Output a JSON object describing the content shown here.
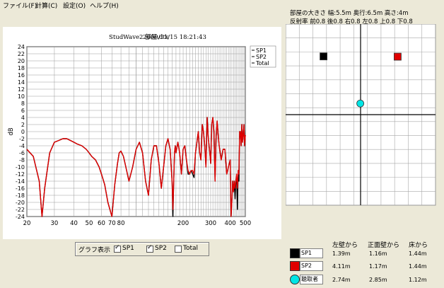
{
  "menu": [
    "ファイル(F)",
    "計算(C)",
    "設定(O)",
    "ヘルプ(H)"
  ],
  "room": {
    "size_text": "部屋の大きさ 幅:5.5m 奥行:6.5m 高さ:4m",
    "reflection_text": "反射率  前0.8  後0.8  右0.8  左0.8  上0.8  下0.8"
  },
  "graph_options": {
    "label": "グラフ表示",
    "items": [
      {
        "label": "SP1",
        "checked": true
      },
      {
        "label": "SP2",
        "checked": true
      },
      {
        "label": "Total",
        "checked": false
      }
    ]
  },
  "distance_table": {
    "headers": [
      "左壁から",
      "正面壁から",
      "床から"
    ],
    "rows": [
      {
        "name": "SP1",
        "color": "#000000",
        "shape": "square",
        "values": [
          "1.39m",
          "1.16m",
          "1.44m"
        ]
      },
      {
        "name": "SP2",
        "color": "#e00000",
        "shape": "square",
        "values": [
          "4.11m",
          "1.17m",
          "1.44m"
        ]
      },
      {
        "name": "聴取者",
        "color": "#00e5e5",
        "shape": "circle",
        "values": [
          "2.74m",
          "2.85m",
          "1.12m"
        ]
      }
    ]
  },
  "chart_data": {
    "type": "line",
    "title": "StudWave2 部屋.dtx",
    "timestamp": "2009/11/15 18:21:43",
    "ylabel": "dB",
    "xlabel": "",
    "x_scale": "log",
    "xlim": [
      20,
      500
    ],
    "ylim": [
      -24,
      24
    ],
    "x_ticks": [
      20,
      30,
      40,
      50,
      60,
      70,
      80,
      100,
      200,
      300,
      400,
      500
    ],
    "x_tick_labels": [
      "20",
      "30",
      "40",
      "50",
      "60",
      "70",
      "80",
      "",
      "200",
      "300",
      "400",
      "500"
    ],
    "y_ticks": [
      24,
      22,
      20,
      18,
      16,
      14,
      12,
      10,
      8,
      6,
      4,
      2,
      0,
      -2,
      -4,
      -6,
      -8,
      -10,
      -12,
      -14,
      -16,
      -18,
      -20,
      -22,
      -24
    ],
    "grid": true,
    "legend": {
      "position": "top-right",
      "entries": [
        "SP1",
        "SP2",
        "Total"
      ]
    },
    "series": [
      {
        "name": "SP1",
        "color": "#000000",
        "x": [
          20,
          22,
          24,
          25,
          26,
          28,
          30,
          32,
          34,
          36,
          38,
          40,
          42,
          45,
          48,
          50,
          52,
          55,
          58,
          60,
          63,
          66,
          70,
          73,
          76,
          78,
          80,
          83,
          86,
          90,
          95,
          100,
          105,
          110,
          115,
          120,
          125,
          130,
          135,
          140,
          145,
          150,
          155,
          160,
          165,
          170,
          172,
          174,
          176,
          178,
          180,
          185,
          190,
          195,
          200,
          205,
          210,
          215,
          220,
          225,
          230,
          235,
          240,
          245,
          250,
          255,
          260,
          265,
          270,
          275,
          280,
          285,
          290,
          295,
          300,
          305,
          310,
          315,
          320,
          325,
          330,
          335,
          340,
          350,
          360,
          370,
          380,
          390,
          400,
          405,
          410,
          415,
          420,
          425,
          430,
          435,
          440,
          445,
          450,
          455,
          460,
          465,
          470,
          475,
          480,
          485,
          490,
          495,
          500
        ],
        "y": [
          -5,
          -7,
          -14,
          -24,
          -16,
          -6,
          -3,
          -2.5,
          -2,
          -2,
          -2.5,
          -3,
          -3.5,
          -4,
          -5,
          -6,
          -7,
          -8,
          -10,
          -12,
          -15,
          -20,
          -24,
          -15,
          -9,
          -6,
          -5.5,
          -7,
          -10,
          -14,
          -10,
          -5,
          -3,
          -6,
          -14,
          -18,
          -8,
          -4,
          -4,
          -9,
          -16,
          -10,
          -4,
          -2,
          -5,
          -14,
          -24,
          -14,
          -6,
          -4,
          -6,
          -3,
          -6,
          -12,
          -5,
          -4,
          -8,
          -12,
          -12,
          -11,
          -12,
          -13,
          -6,
          -3,
          0,
          -6,
          -8,
          2,
          0,
          -4,
          -10,
          4,
          -2,
          -5,
          -9,
          2,
          4,
          0,
          -14,
          -2,
          3,
          -1,
          -4,
          -8,
          -5,
          -5,
          -12,
          -10,
          -8,
          -24,
          -20,
          -14,
          -17,
          -14,
          -19,
          -14,
          -13,
          -22,
          -11,
          -14,
          0,
          0,
          -4,
          2,
          -3,
          -1,
          2,
          -4,
          -1
        ]
      },
      {
        "name": "SP2",
        "color": "#e00000",
        "x": [
          20,
          22,
          24,
          25,
          26,
          28,
          30,
          32,
          34,
          36,
          38,
          40,
          42,
          45,
          48,
          50,
          52,
          55,
          58,
          60,
          63,
          66,
          70,
          73,
          76,
          78,
          80,
          83,
          86,
          90,
          95,
          100,
          105,
          110,
          115,
          120,
          125,
          130,
          135,
          140,
          145,
          150,
          155,
          160,
          165,
          170,
          172,
          174,
          176,
          178,
          180,
          185,
          190,
          195,
          200,
          205,
          210,
          215,
          220,
          225,
          230,
          235,
          240,
          245,
          250,
          255,
          260,
          265,
          270,
          275,
          280,
          285,
          290,
          295,
          300,
          305,
          310,
          315,
          320,
          325,
          330,
          335,
          340,
          350,
          360,
          370,
          380,
          390,
          400,
          405,
          410,
          415,
          420,
          425,
          430,
          435,
          440,
          445,
          450,
          455,
          460,
          465,
          470,
          475,
          480,
          485,
          490,
          495,
          500
        ],
        "y": [
          -5,
          -7,
          -14,
          -24,
          -16,
          -6,
          -3,
          -2.5,
          -2,
          -2,
          -2.5,
          -3,
          -3.5,
          -4,
          -5,
          -6,
          -7,
          -8,
          -10,
          -12,
          -15,
          -20,
          -24,
          -15,
          -9,
          -6,
          -5.5,
          -7,
          -10,
          -14,
          -10,
          -5,
          -3,
          -6,
          -14,
          -18,
          -8,
          -4,
          -4,
          -9,
          -16,
          -10,
          -4,
          -2,
          -5,
          -14,
          -22,
          -14,
          -6,
          -4,
          -6,
          -3,
          -6,
          -12,
          -5,
          -4,
          -8,
          -11,
          -12,
          -11,
          -11,
          -12,
          -6,
          -3,
          0,
          -6,
          -8,
          2,
          0,
          -4,
          -10,
          4,
          -2,
          -5,
          -9,
          2,
          4,
          0,
          -14,
          -2,
          3,
          -1,
          -4,
          -8,
          -5,
          -5,
          -12,
          -10,
          -8,
          -24,
          -20,
          -14,
          -17,
          -14,
          -16,
          -14,
          -12,
          -16,
          -11,
          -12,
          0,
          0,
          -4,
          2,
          -3,
          -1,
          2,
          -4,
          -1
        ]
      }
    ]
  }
}
